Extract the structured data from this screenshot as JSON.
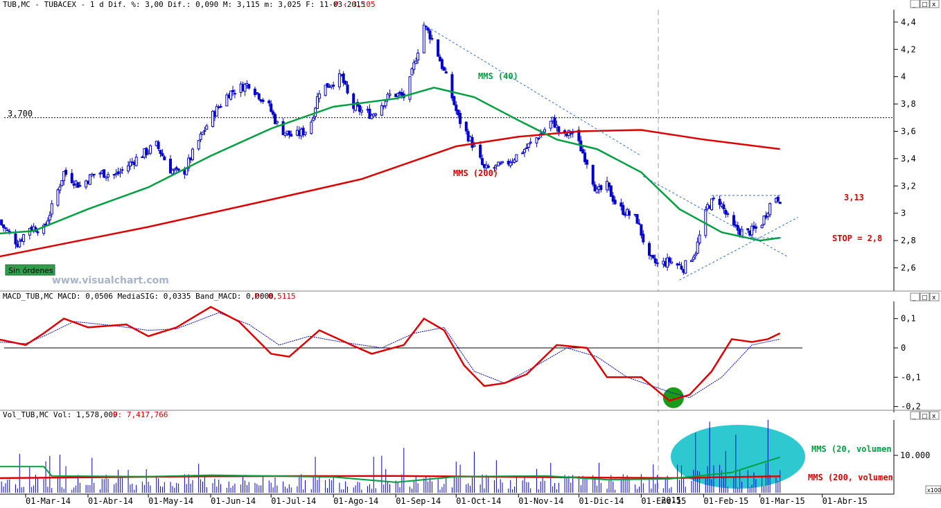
{
  "header": {
    "main": "TUB,MC - TUBACEX -  1 d Dif. %: 3,00 Dif.: 0,090 M: 3,115 m: 3,025 F: 11-03-2015",
    "main_p": "P : 3,105",
    "macd": "MACD_TUB,MC MACD: 0,0506 MediaSIG: 0,0335 Band_MACD: 0,0000",
    "macd_p": "P: 0,5115",
    "vol": "Vol_TUB,MC Vol: 1,578,009",
    "vol_p": "P: 7,417,766"
  },
  "window_buttons": [
    "_",
    "□",
    "x"
  ],
  "badge": "Sin órdenes",
  "watermark": "www.visualchart.com",
  "x_axis": {
    "labels": [
      "01-Mar-14",
      "01-Abr-14",
      "01-May-14",
      "01-Jun-14",
      "01-Jul-14",
      "01-Ago-14",
      "01-Sep-14",
      "01-Oct-14",
      "01-Nov-14",
      "01-Dic-14",
      "01-Ene-15",
      "01-Feb-15",
      "01-Mar-15",
      "01-Abr-15"
    ],
    "year_marker": "2015"
  },
  "colors": {
    "candles": "#0000cc",
    "sma40": "#00a040",
    "sma200": "#dd0000",
    "macd": "#dd0000",
    "signal": "#0000cc",
    "header_p": "#dd0000",
    "ellipse": "#2ec8d0",
    "circle": "#1a9a1a"
  },
  "chart_data": [
    {
      "type": "candlestick",
      "title": "TUB,MC - TUBACEX",
      "ylim": [
        2.45,
        4.45
      ],
      "yticks": [
        "4,4",
        "4,2",
        "4",
        "3,8",
        "3,6",
        "3,4",
        "3,2",
        "3",
        "2,8",
        "2,6"
      ],
      "anchors": [
        [
          "2014-02-15",
          2.95
        ],
        [
          "2014-02-25",
          2.78
        ],
        [
          "2014-03-03",
          2.9
        ],
        [
          "2014-03-10",
          2.88
        ],
        [
          "2014-03-15",
          3.08
        ],
        [
          "2014-03-20",
          3.3
        ],
        [
          "2014-03-28",
          3.2
        ],
        [
          "2014-04-05",
          3.3
        ],
        [
          "2014-04-15",
          3.28
        ],
        [
          "2014-04-25",
          3.4
        ],
        [
          "2014-05-05",
          3.5
        ],
        [
          "2014-05-12",
          3.32
        ],
        [
          "2014-05-18",
          3.28
        ],
        [
          "2014-05-25",
          3.5
        ],
        [
          "2014-06-01",
          3.7
        ],
        [
          "2014-06-10",
          3.88
        ],
        [
          "2014-06-20",
          3.95
        ],
        [
          "2014-06-30",
          3.78
        ],
        [
          "2014-07-05",
          3.62
        ],
        [
          "2014-07-12",
          3.56
        ],
        [
          "2014-07-20",
          3.62
        ],
        [
          "2014-07-25",
          3.9
        ],
        [
          "2014-08-05",
          4.0
        ],
        [
          "2014-08-10",
          3.78
        ],
        [
          "2014-08-20",
          3.72
        ],
        [
          "2014-08-30",
          3.88
        ],
        [
          "2014-09-06",
          3.85
        ],
        [
          "2014-09-12",
          4.2
        ],
        [
          "2014-09-15",
          4.38
        ],
        [
          "2014-09-20",
          4.25
        ],
        [
          "2014-09-27",
          3.95
        ],
        [
          "2014-10-02",
          3.7
        ],
        [
          "2014-10-10",
          3.48
        ],
        [
          "2014-10-15",
          3.32
        ],
        [
          "2014-10-25",
          3.35
        ],
        [
          "2014-11-05",
          3.48
        ],
        [
          "2014-11-12",
          3.58
        ],
        [
          "2014-11-18",
          3.68
        ],
        [
          "2014-11-23",
          3.55
        ],
        [
          "2014-11-28",
          3.6
        ],
        [
          "2014-12-05",
          3.38
        ],
        [
          "2014-12-10",
          3.15
        ],
        [
          "2014-12-15",
          3.2
        ],
        [
          "2014-12-20",
          3.05
        ],
        [
          "2014-12-30",
          2.95
        ],
        [
          "2015-01-05",
          2.66
        ],
        [
          "2015-01-10",
          2.62
        ],
        [
          "2015-01-15",
          2.65
        ],
        [
          "2015-01-22",
          2.6
        ],
        [
          "2015-01-28",
          2.72
        ],
        [
          "2015-02-03",
          3.05
        ],
        [
          "2015-02-08",
          3.12
        ],
        [
          "2015-02-15",
          2.9
        ],
        [
          "2015-02-22",
          2.85
        ],
        [
          "2015-03-01",
          2.9
        ],
        [
          "2015-03-08",
          3.13
        ],
        [
          "2015-03-11",
          3.105
        ]
      ],
      "sma40": [
        [
          "2014-02-15",
          2.85
        ],
        [
          "2014-03-05",
          2.87
        ],
        [
          "2014-04-01",
          3.03
        ],
        [
          "2014-05-01",
          3.19
        ],
        [
          "2014-06-01",
          3.42
        ],
        [
          "2014-07-01",
          3.62
        ],
        [
          "2014-08-01",
          3.78
        ],
        [
          "2014-09-01",
          3.84
        ],
        [
          "2014-09-20",
          3.92
        ],
        [
          "2014-10-10",
          3.85
        ],
        [
          "2014-11-01",
          3.68
        ],
        [
          "2014-11-20",
          3.54
        ],
        [
          "2014-12-10",
          3.47
        ],
        [
          "2015-01-01",
          3.3
        ],
        [
          "2015-01-20",
          3.03
        ],
        [
          "2015-02-10",
          2.86
        ],
        [
          "2015-03-01",
          2.8
        ],
        [
          "2015-03-11",
          2.82
        ]
      ],
      "sma200": [
        [
          "2014-02-15",
          2.68
        ],
        [
          "2014-05-01",
          2.9
        ],
        [
          "2014-07-01",
          3.1
        ],
        [
          "2014-08-15",
          3.25
        ],
        [
          "2014-10-01",
          3.49
        ],
        [
          "2014-11-01",
          3.56
        ],
        [
          "2014-12-01",
          3.6
        ],
        [
          "2015-01-01",
          3.61
        ],
        [
          "2015-02-01",
          3.54
        ],
        [
          "2015-03-11",
          3.47
        ]
      ],
      "reference_line": {
        "label": "3,700",
        "value": 3.7
      },
      "annotations": {
        "sma40_label": "MMS (40)",
        "sma200_label": "MMS (200)",
        "resistance_label": "3,13",
        "stop_label": "STOP = 2,8"
      },
      "trendlines": [
        {
          "from": [
            "2014-09-15",
            4.38
          ],
          "to": [
            "2015-01-01",
            3.42
          ]
        },
        {
          "from": [
            "2015-01-02",
            3.27
          ],
          "to": [
            "2015-03-15",
            2.68
          ]
        },
        {
          "from": [
            "2015-01-20",
            2.51
          ],
          "to": [
            "2015-03-20",
            2.97
          ]
        },
        {
          "from": [
            "2015-02-05",
            3.13
          ],
          "to": [
            "2015-03-12",
            3.13
          ]
        },
        {
          "from": [
            "2015-02-20",
            2.82
          ],
          "to": [
            "2015-03-12",
            2.82
          ]
        }
      ]
    },
    {
      "type": "line",
      "title": "MACD_TUB,MC",
      "ylim": [
        -0.23,
        0.16
      ],
      "yticks": [
        "0,1",
        "0",
        "-0,1",
        "-0,2"
      ],
      "series": [
        {
          "name": "MACD",
          "points": [
            [
              "2014-02-15",
              0.03
            ],
            [
              "2014-03-01",
              0.01
            ],
            [
              "2014-03-10",
              0.05
            ],
            [
              "2014-03-20",
              0.1
            ],
            [
              "2014-04-01",
              0.07
            ],
            [
              "2014-04-20",
              0.08
            ],
            [
              "2014-05-01",
              0.04
            ],
            [
              "2014-05-15",
              0.07
            ],
            [
              "2014-06-01",
              0.14
            ],
            [
              "2014-06-15",
              0.09
            ],
            [
              "2014-07-01",
              -0.02
            ],
            [
              "2014-07-10",
              -0.03
            ],
            [
              "2014-07-25",
              0.06
            ],
            [
              "2014-08-10",
              0.01
            ],
            [
              "2014-08-20",
              -0.02
            ],
            [
              "2014-09-05",
              0.01
            ],
            [
              "2014-09-15",
              0.1
            ],
            [
              "2014-09-25",
              0.06
            ],
            [
              "2014-10-05",
              -0.06
            ],
            [
              "2014-10-15",
              -0.13
            ],
            [
              "2014-10-25",
              -0.12
            ],
            [
              "2014-11-05",
              -0.09
            ],
            [
              "2014-11-20",
              0.01
            ],
            [
              "2014-12-05",
              0.0
            ],
            [
              "2014-12-15",
              -0.1
            ],
            [
              "2015-01-01",
              -0.1
            ],
            [
              "2015-01-15",
              -0.18
            ],
            [
              "2015-01-25",
              -0.16
            ],
            [
              "2015-02-05",
              -0.08
            ],
            [
              "2015-02-15",
              0.03
            ],
            [
              "2015-02-25",
              0.02
            ],
            [
              "2015-03-05",
              0.03
            ],
            [
              "2015-03-11",
              0.05
            ]
          ]
        },
        {
          "name": "MediaSIG",
          "points": [
            [
              "2014-02-15",
              0.02
            ],
            [
              "2014-03-01",
              0.015
            ],
            [
              "2014-03-10",
              0.04
            ],
            [
              "2014-03-25",
              0.09
            ],
            [
              "2014-04-15",
              0.075
            ],
            [
              "2014-05-01",
              0.06
            ],
            [
              "2014-05-15",
              0.065
            ],
            [
              "2014-06-05",
              0.12
            ],
            [
              "2014-06-20",
              0.08
            ],
            [
              "2014-07-05",
              0.01
            ],
            [
              "2014-07-20",
              0.04
            ],
            [
              "2014-08-05",
              0.02
            ],
            [
              "2014-08-25",
              0.0
            ],
            [
              "2014-09-10",
              0.05
            ],
            [
              "2014-09-25",
              0.07
            ],
            [
              "2014-10-10",
              -0.08
            ],
            [
              "2014-10-25",
              -0.12
            ],
            [
              "2014-11-10",
              -0.06
            ],
            [
              "2014-11-25",
              0.0
            ],
            [
              "2014-12-10",
              -0.03
            ],
            [
              "2014-12-25",
              -0.1
            ],
            [
              "2015-01-15",
              -0.15
            ],
            [
              "2015-01-25",
              -0.17
            ],
            [
              "2015-02-10",
              -0.1
            ],
            [
              "2015-02-25",
              0.01
            ],
            [
              "2015-03-11",
              0.03
            ]
          ]
        }
      ],
      "circle_marker": {
        "x": "2015-01-17",
        "y": -0.17
      }
    },
    {
      "type": "bar",
      "title": "Vol_TUB,MC",
      "ylim": [
        0,
        20000
      ],
      "ytick_label": "10.000",
      "ytick_value": 10000,
      "axis_multiplier": "x100",
      "series": [
        {
          "name": "MMS (20, volumen",
          "points": [
            [
              "2014-02-15",
              7000
            ],
            [
              "2014-03-10",
              7000
            ],
            [
              "2014-03-14",
              4500
            ],
            [
              "2014-05-01",
              4300
            ],
            [
              "2014-06-01",
              4700
            ],
            [
              "2014-08-01",
              4200
            ],
            [
              "2014-09-01",
              2800
            ],
            [
              "2014-10-01",
              4300
            ],
            [
              "2014-11-15",
              4500
            ],
            [
              "2014-12-15",
              3500
            ],
            [
              "2015-01-15",
              3700
            ],
            [
              "2015-02-15",
              5400
            ],
            [
              "2015-03-05",
              8500
            ],
            [
              "2015-03-11",
              9500
            ]
          ]
        },
        {
          "name": "MMS (200, volumen",
          "points": [
            [
              "2014-02-15",
              3900
            ],
            [
              "2014-06-01",
              4400
            ],
            [
              "2014-09-01",
              4500
            ],
            [
              "2014-12-01",
              4100
            ],
            [
              "2015-01-15",
              3900
            ],
            [
              "2015-03-11",
              4400
            ]
          ]
        }
      ],
      "spikes": [
        [
          "2014-03-08",
          18000
        ],
        [
          "2014-06-01",
          13000
        ],
        [
          "2014-09-05",
          12000
        ],
        [
          "2014-10-10",
          11000
        ],
        [
          "2014-11-01",
          13500
        ],
        [
          "2015-01-28",
          16000
        ],
        [
          "2015-02-04",
          19000
        ],
        [
          "2015-02-17",
          15500
        ],
        [
          "2015-03-05",
          19500
        ],
        [
          "2015-03-08",
          17500
        ]
      ]
    }
  ]
}
